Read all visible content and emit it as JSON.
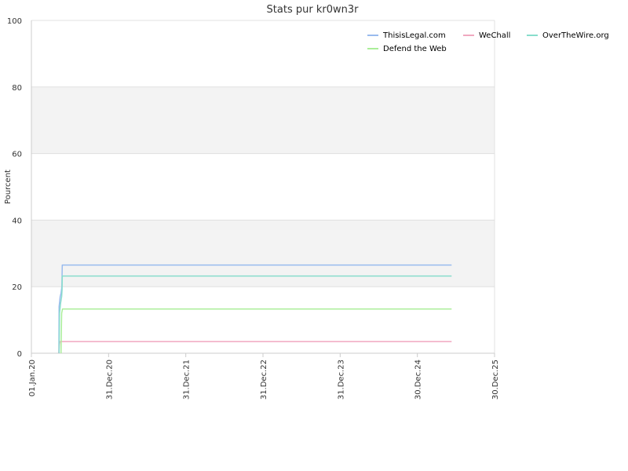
{
  "chart_data": {
    "type": "line",
    "title": "Stats pur kr0wn3r",
    "xlabel": "",
    "ylabel": "Pourcent",
    "ylim": [
      0,
      100
    ],
    "yticks": [
      0,
      20,
      40,
      60,
      80,
      100
    ],
    "xlim": [
      "2020-01-01",
      "2025-12-30"
    ],
    "xticks": [
      {
        "date": "2020-01-01",
        "label": "01.Jan.20"
      },
      {
        "date": "2020-12-31",
        "label": "31.Dec.20"
      },
      {
        "date": "2021-12-31",
        "label": "31.Dec.21"
      },
      {
        "date": "2022-12-31",
        "label": "31.Dec.22"
      },
      {
        "date": "2023-12-31",
        "label": "31.Dec.23"
      },
      {
        "date": "2024-12-30",
        "label": "30.Dec.24"
      },
      {
        "date": "2025-12-30",
        "label": "30.Dec.25"
      }
    ],
    "grid": true,
    "alternating_bands": true,
    "legend_position": "top-right",
    "series": [
      {
        "name": "ThisisLegal.com",
        "color": "#99bbee",
        "points": [
          [
            "2020-05-10",
            0
          ],
          [
            "2020-05-11",
            14
          ],
          [
            "2020-05-16",
            17
          ],
          [
            "2020-05-20",
            18
          ],
          [
            "2020-05-24",
            20
          ],
          [
            "2020-05-26",
            26.5
          ],
          [
            "2025-06-10",
            26.5
          ]
        ]
      },
      {
        "name": "WeChall",
        "color": "#f0a8c0",
        "points": [
          [
            "2020-05-10",
            0
          ],
          [
            "2020-05-12",
            2.5
          ],
          [
            "2020-05-15",
            3.5
          ],
          [
            "2025-06-10",
            3.5
          ]
        ]
      },
      {
        "name": "OverTheWire.org",
        "color": "#88ddcc",
        "points": [
          [
            "2020-05-11",
            0
          ],
          [
            "2020-05-13",
            12
          ],
          [
            "2020-05-18",
            15
          ],
          [
            "2020-05-23",
            17
          ],
          [
            "2020-05-25",
            19
          ],
          [
            "2020-05-26",
            23.2
          ],
          [
            "2025-06-10",
            23.2
          ]
        ]
      },
      {
        "name": "Defend the Web",
        "color": "#aaee99",
        "points": [
          [
            "2020-05-20",
            0
          ],
          [
            "2020-05-23",
            12
          ],
          [
            "2020-05-27",
            13.3
          ],
          [
            "2025-06-10",
            13.3
          ]
        ]
      }
    ]
  }
}
